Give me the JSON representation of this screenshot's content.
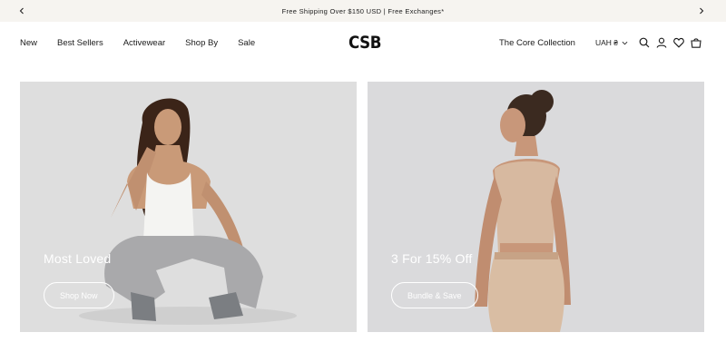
{
  "announcement": {
    "text": "Free Shipping Over $150 USD | Free Exchanges*",
    "prev_icon": "chevron-left",
    "next_icon": "chevron-right"
  },
  "header": {
    "logo": "CSB",
    "nav": [
      "New",
      "Best Sellers",
      "Activewear",
      "Shop By",
      "Sale"
    ],
    "core_collection": "The Core Collection",
    "currency": "UAH ₴",
    "icons": [
      "search",
      "account",
      "wishlist-heart",
      "cart-bag"
    ]
  },
  "promos": [
    {
      "title": "Most Loved",
      "button": "Shop Now",
      "image": "woman-white-tank-grey-pants-seated"
    },
    {
      "title": "3 For 15% Off",
      "button": "Bundle & Save",
      "image": "woman-beige-set-back-view"
    }
  ],
  "colors": {
    "announcement_bg": "#f6f4f0",
    "text": "#1a1a1a",
    "promo_bg_left": "#dcdcdc",
    "promo_bg_right": "#d9d9db"
  }
}
